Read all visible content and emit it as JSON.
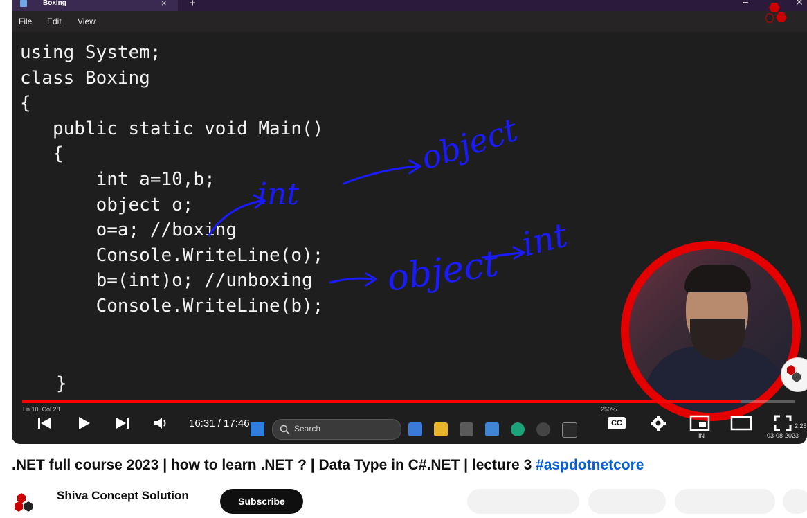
{
  "editor": {
    "tab_title": "Boxing",
    "tab_close_glyph": "×",
    "new_tab_glyph": "+",
    "window_minimize_glyph": "–",
    "window_close_glyph": "✕",
    "menu": [
      "File",
      "Edit",
      "View"
    ],
    "code_lines": [
      "using System;",
      "class Boxing",
      "{",
      "   public static void Main()",
      "   {",
      "       int a=10,b;",
      "       object o;",
      "       o=a; //boxing",
      "       Console.WriteLine(o);",
      "       b=(int)o; //unboxing",
      "       Console.WriteLine(b);"
    ],
    "closing_brace": "}",
    "status_position": "Ln 10, Col 28",
    "zoom": "250%"
  },
  "annotations": {
    "arrow1_from": "int",
    "arrow1_to": "object",
    "arrow2_from": "object",
    "arrow2_to": "int",
    "ink_color": "#1a1aff"
  },
  "taskbar": {
    "search_label": "Search",
    "clock_time": "2:25",
    "clock_date": "03-08-2023",
    "lang": "IN"
  },
  "player": {
    "time_display": "16:31 / 17:46",
    "progress_fraction": 0.93,
    "accent_color": "#ff0000",
    "icons": [
      "previous-icon",
      "play-icon",
      "next-icon",
      "volume-icon",
      "captions-icon",
      "settings-icon",
      "miniplayer-icon",
      "theater-icon",
      "fullscreen-icon"
    ],
    "cc_label": "CC"
  },
  "logo_text": "Shiva Concept Solution",
  "video": {
    "title": ".NET full course 2023 | how to learn .NET ? | Data Type in C#.NET | lecture 3 ",
    "hashtag": "#aspdotnetcore",
    "channel_name": "Shiva Concept Solution",
    "subscribe_label": "Subscribe"
  }
}
